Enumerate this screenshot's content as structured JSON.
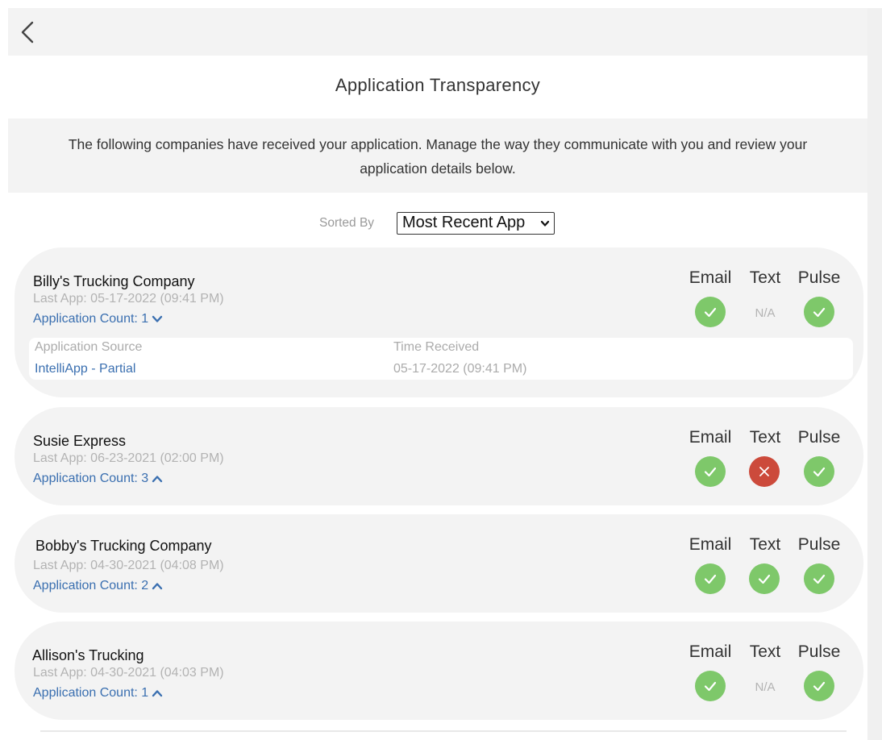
{
  "header": {
    "title": "Application Transparency"
  },
  "description": "The following companies have received your application. Manage the way they communicate with you and review your application details below.",
  "sort": {
    "label": "Sorted By",
    "selected": "Most Recent App"
  },
  "columns": {
    "email": "Email",
    "text": "Text",
    "pulse": "Pulse"
  },
  "companies": [
    {
      "name": "Billy's Trucking Company",
      "last_app": "Last App: 05-17-2022 (09:41 PM)",
      "app_count": "Application Count: 1",
      "expanded": true,
      "email": "enabled",
      "text": "N/A",
      "pulse": "enabled",
      "details": {
        "source_label": "Application Source",
        "source_value": "IntelliApp - Partial",
        "time_label": "Time Received",
        "time_value": "05-17-2022 (09:41 PM)"
      }
    },
    {
      "name": "Susie Express",
      "last_app": "Last App: 06-23-2021 (02:00 PM)",
      "app_count": "Application Count: 3",
      "expanded": false,
      "email": "enabled",
      "text": "disabled",
      "pulse": "enabled"
    },
    {
      "name": "Bobby's Trucking Company",
      "last_app": "Last App: 04-30-2021 (04:08 PM)",
      "app_count": "Application Count: 2",
      "expanded": false,
      "email": "enabled",
      "text": "enabled",
      "pulse": "enabled"
    },
    {
      "name": "Allison's Trucking",
      "last_app": "Last App: 04-30-2021 (04:03 PM)",
      "app_count": "Application Count: 1",
      "expanded": false,
      "email": "enabled",
      "text": "N/A",
      "pulse": "enabled"
    }
  ],
  "icons": {
    "back": "chevron-left-icon",
    "enabled": "check-icon",
    "disabled": "x-icon",
    "collapsed": "chevron-down-icon",
    "expanded": "chevron-up-icon"
  },
  "colors": {
    "enabled": "#7ec86a",
    "disabled": "#cc4a3b",
    "link": "#3a6fb0",
    "card_bg": "#f3f3f3"
  }
}
